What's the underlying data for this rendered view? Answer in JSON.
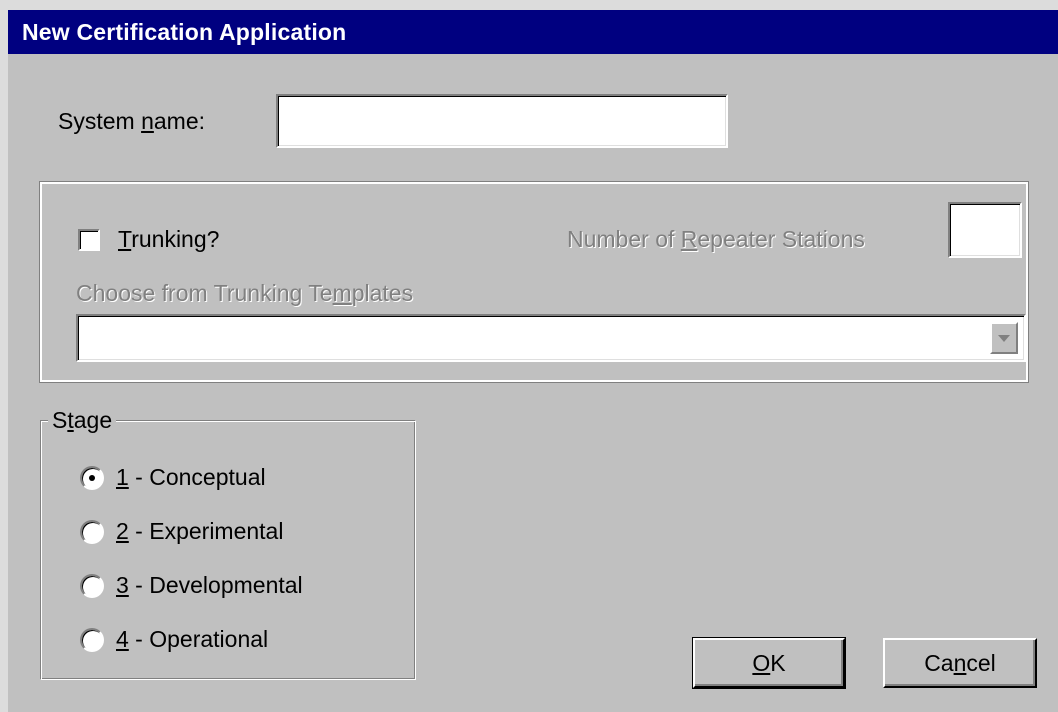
{
  "window": {
    "title": "New Certification Application"
  },
  "system_name": {
    "label_pre": "System ",
    "label_accel": "n",
    "label_post": "ame:",
    "value": ""
  },
  "trunking": {
    "checkbox_accel": "T",
    "checkbox_post": "runking?",
    "checked": false,
    "repeater_pre": "Number of ",
    "repeater_accel": "R",
    "repeater_post": "epeater Stations",
    "repeater_value": "",
    "templates_pre": "Choose from Trunking Te",
    "templates_accel": "m",
    "templates_post": "plates",
    "templates_value": ""
  },
  "stage": {
    "legend_pre": "S",
    "legend_accel": "t",
    "legend_post": "age",
    "options": [
      {
        "accel": "1",
        "label": " - Conceptual",
        "selected": true
      },
      {
        "accel": "2",
        "label": " - Experimental",
        "selected": false
      },
      {
        "accel": "3",
        "label": " - Developmental",
        "selected": false
      },
      {
        "accel": "4",
        "label": " - Operational",
        "selected": false
      }
    ]
  },
  "buttons": {
    "ok_accel": "O",
    "ok_post": "K",
    "cancel_pre": "Ca",
    "cancel_accel": "n",
    "cancel_post": "cel"
  },
  "colors": {
    "titlebar": "#000080",
    "face": "#c0c0c0",
    "disabled_text": "#808080"
  }
}
